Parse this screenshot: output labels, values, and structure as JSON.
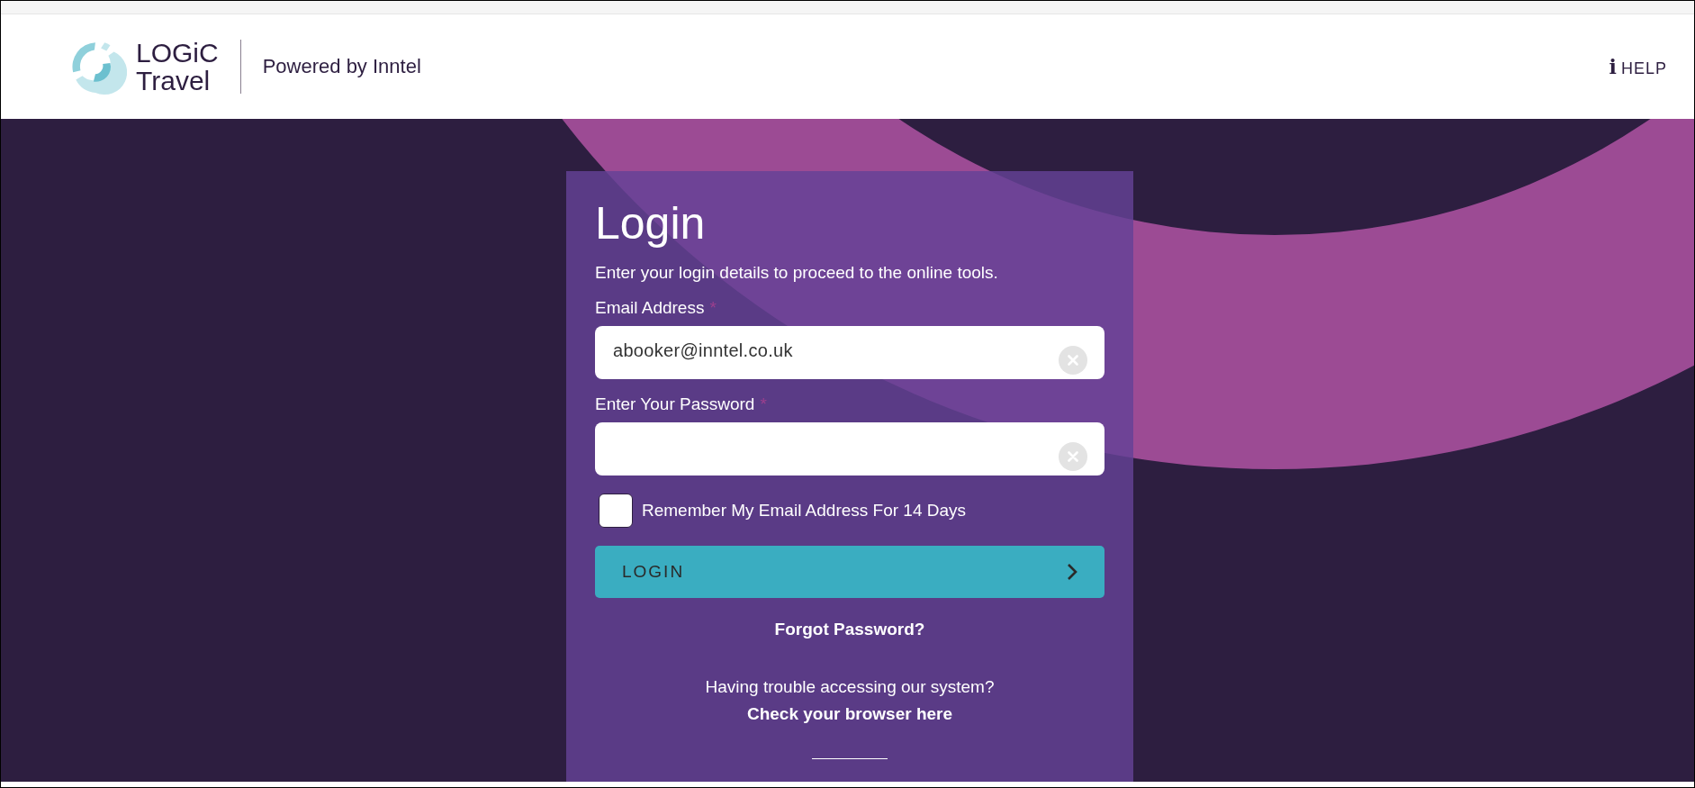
{
  "header": {
    "logo": {
      "line_1": "LOGiC",
      "line_2": "Travel"
    },
    "tagline": "Powered by Inntel",
    "help": {
      "icon": "i",
      "label": "HELP"
    }
  },
  "login": {
    "title": "Login",
    "intro": "Enter your login details to proceed to the online tools.",
    "fields": [
      {
        "kind": "text",
        "label": "Email Address",
        "required_mark": "*",
        "value": "abooker@inntel.co.uk"
      },
      {
        "kind": "password",
        "label": "Enter Your Password",
        "required_mark": "*"
      }
    ],
    "remember": {
      "label": "Remember My Email Address For 14 Days",
      "checked": false
    },
    "button": "LOGIN",
    "forgot": "Forgot Password?",
    "trouble": "Having trouble accessing our system?",
    "browser_link": "Check your browser here"
  }
}
